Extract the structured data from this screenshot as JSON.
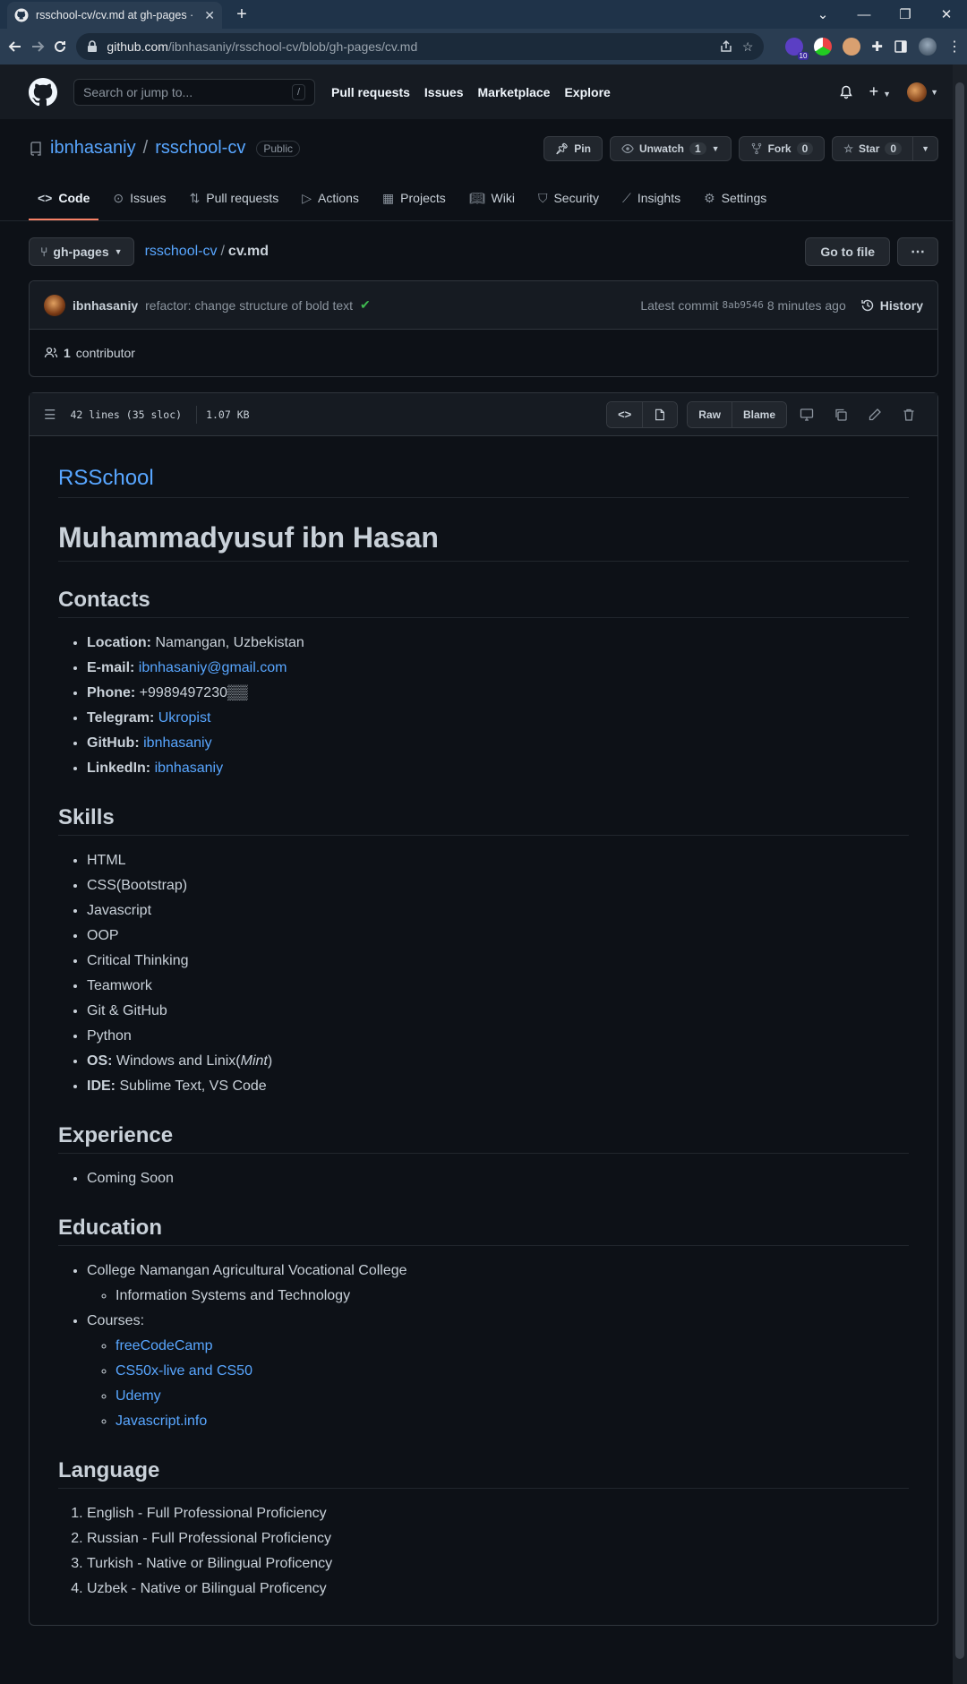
{
  "browser": {
    "tab_title": "rsschool-cv/cv.md at gh-pages · ibnhasaniy/rsschool-cv",
    "url_domain": "github.com",
    "url_path": "/ibnhasaniy/rsschool-cv/blob/gh-pages/cv.md",
    "ext_badge": "10"
  },
  "header": {
    "search_placeholder": "Search or jump to...",
    "search_kbd": "/",
    "nav": [
      "Pull requests",
      "Issues",
      "Marketplace",
      "Explore"
    ]
  },
  "repo": {
    "owner": "ibnhasaniy",
    "name": "rsschool-cv",
    "visibility": "Public",
    "pin_label": "Pin",
    "watch_label": "Unwatch",
    "watch_count": "1",
    "fork_label": "Fork",
    "fork_count": "0",
    "star_label": "Star",
    "star_count": "0",
    "tabs": [
      "Code",
      "Issues",
      "Pull requests",
      "Actions",
      "Projects",
      "Wiki",
      "Security",
      "Insights",
      "Settings"
    ]
  },
  "file_nav": {
    "branch": "gh-pages",
    "repo_link": "rsschool-cv",
    "file": "cv.md",
    "go_to_file": "Go to file"
  },
  "commit": {
    "author": "ibnhasaniy",
    "message": "refactor: change structure of bold text",
    "latest_label": "Latest commit",
    "sha": "8ab9546",
    "time": "8 minutes ago",
    "history": "History",
    "contributors_count": "1",
    "contributors_label": "contributor"
  },
  "file_info": {
    "lines": "42 lines (35 sloc)",
    "size": "1.07 KB",
    "raw": "Raw",
    "blame": "Blame"
  },
  "doc": {
    "school": "RSSchool",
    "name": "Muhammadyusuf ibn Hasan",
    "contacts_h": "Contacts",
    "contacts": [
      {
        "label": "Location:",
        "value": "Namangan, Uzbekistan",
        "link": false
      },
      {
        "label": "E-mail:",
        "value": "ibnhasaniy@gmail.com",
        "link": true
      },
      {
        "label": "Phone:",
        "value": "+9989497230▒▒",
        "link": false
      },
      {
        "label": "Telegram:",
        "value": "Ukropist",
        "link": true
      },
      {
        "label": "GitHub:",
        "value": "ibnhasaniy",
        "link": true
      },
      {
        "label": "LinkedIn:",
        "value": "ibnhasaniy",
        "link": true
      }
    ],
    "skills_h": "Skills",
    "skills": [
      "HTML",
      "CSS(Bootstrap)",
      "Javascript",
      "OOP",
      "Critical Thinking",
      "Teamwork",
      "Git & GitHub",
      "Python"
    ],
    "os_label": "OS:",
    "os_value": "Windows and Linix(",
    "os_em": "Mint",
    "os_close": ")",
    "ide_label": "IDE:",
    "ide_value": "Sublime Text, VS Code",
    "experience_h": "Experience",
    "experience": [
      "Coming Soon"
    ],
    "education_h": "Education",
    "college": "College Namangan Agricultural Vocational College",
    "college_sub": "Information Systems and Technology",
    "courses_label": "Courses:",
    "courses": [
      "freeCodeCamp",
      "CS50x-live and CS50",
      "Udemy",
      "Javascript.info"
    ],
    "language_h": "Language",
    "languages": [
      "English - Full Professional Proficiency",
      "Russian - Full Professional Proficiency",
      "Turkish - Native or Bilingual Proficency",
      "Uzbek - Native or Bilingual Proficency"
    ]
  },
  "colors": {
    "accent": "#58a6ff",
    "bg": "#0d1117",
    "tab_underline": "#f78166",
    "success": "#3fb950"
  }
}
